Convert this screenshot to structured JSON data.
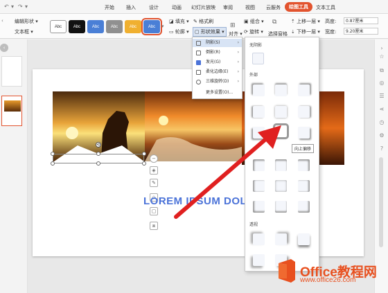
{
  "tabs": [
    "开始",
    "插入",
    "设计",
    "动画",
    "幻灯片放映",
    "审阅",
    "视图",
    "云服务",
    "绘图工具",
    "文本工具"
  ],
  "active_tab": "绘图工具",
  "ribbon": {
    "edit_shape": "编辑形状",
    "text_box": "文本框",
    "swatch_label": "Abc",
    "fill": "填充",
    "format_painter": "格式刷",
    "outline": "轮廓",
    "shape_effects": "形状效果",
    "align": "对齐",
    "group": "组合",
    "rotate": "旋转",
    "selection_pane": "选择窗格",
    "bring_forward": "上移一层",
    "send_backward": "下移一层",
    "height_label": "高度:",
    "height_value": "0.87厘米",
    "width_label": "宽度:",
    "width_value": "9.20厘米"
  },
  "swatch_colors": [
    "#ffffff",
    "#111111",
    "#4a7fd6",
    "#909090",
    "#f0b030",
    "#4a7fd6"
  ],
  "effects_menu": {
    "items": [
      {
        "label": "阴影(S)",
        "arrow": "›"
      },
      {
        "label": "倒影(R)",
        "arrow": "›"
      },
      {
        "label": "发光(G)",
        "arrow": "›"
      },
      {
        "label": "柔化边缘(E)",
        "arrow": "›"
      },
      {
        "label": "三维旋转(D)",
        "arrow": "›"
      },
      {
        "label": "更多设置(O)...",
        "arrow": ""
      }
    ]
  },
  "shadow_menu": {
    "no_shadow": "无阴影",
    "outer": "外部",
    "perspective": "透视",
    "tooltip": "向上偏移"
  },
  "slide": {
    "title": "LOREM IPSUM DOLOR"
  },
  "watermark": {
    "brand": "Office教程网",
    "url": "www.office26.com"
  }
}
